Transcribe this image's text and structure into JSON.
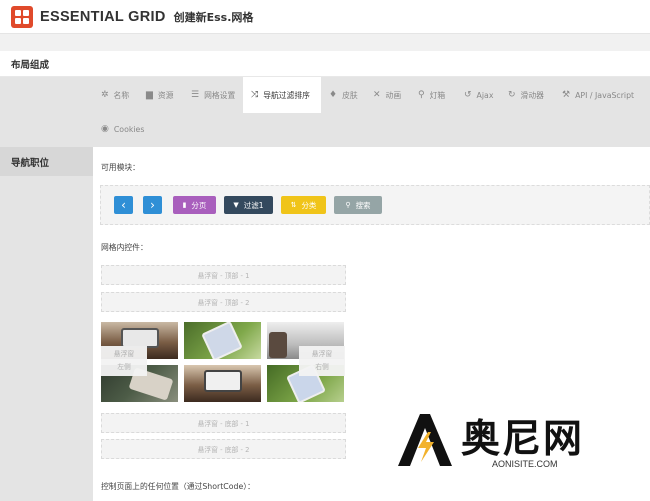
{
  "header": {
    "brand": "ESSENTIAL GRID",
    "subtitle": "创建新Ess.网格"
  },
  "section": {
    "title": "布局组成"
  },
  "left_nav": {
    "active_item": "导航职位"
  },
  "tabs": [
    {
      "label": "名称",
      "icon": "gear-icon"
    },
    {
      "label": "资源",
      "icon": "folder-icon"
    },
    {
      "label": "网格设置",
      "icon": "list-icon"
    },
    {
      "label": "导航过滤排序",
      "icon": "shuffle-icon",
      "active": true
    },
    {
      "label": "皮肤",
      "icon": "drop-icon"
    },
    {
      "label": "动画",
      "icon": "tools-icon"
    },
    {
      "label": "灯箱",
      "icon": "search-icon"
    },
    {
      "label": "Ajax",
      "icon": "undo-icon"
    },
    {
      "label": "滑动器",
      "icon": "history-icon"
    },
    {
      "label": "API / JavaScript",
      "icon": "magic-icon"
    },
    {
      "label": "Cookies",
      "icon": "eye-icon"
    }
  ],
  "main": {
    "available_modules_label": "可用模块：",
    "grid_controls_label": "网格内控件：",
    "shortcode_label": "控制页面上的任何位置（通过ShortCode）：",
    "modules": {
      "prev_icon": "‹",
      "next_icon": "›",
      "pagination": "分页",
      "filter": "过滤1",
      "sort": "分类",
      "search": "搜索"
    },
    "placeholders": {
      "top1": "悬浮窗 - 顶部 - 1",
      "top2": "悬浮窗 - 顶部 - 2",
      "left": "悬浮窗",
      "left_sub": "左侧",
      "right": "悬浮窗",
      "right_sub": "右侧",
      "bottom1": "悬浮窗 - 底部 - 1",
      "bottom2": "悬浮窗 - 底部 - 2"
    }
  },
  "watermark": {
    "text": "奥尼网",
    "url": "AONISITE.COM"
  },
  "colors": {
    "nav_blue": "#2f8fd6",
    "pagination_purple": "#a95fbd",
    "filter_navy": "#34495e",
    "sort_yellow": "#f0c419",
    "search_gray": "#95a5a6",
    "brand_red": "#e04a2b"
  }
}
